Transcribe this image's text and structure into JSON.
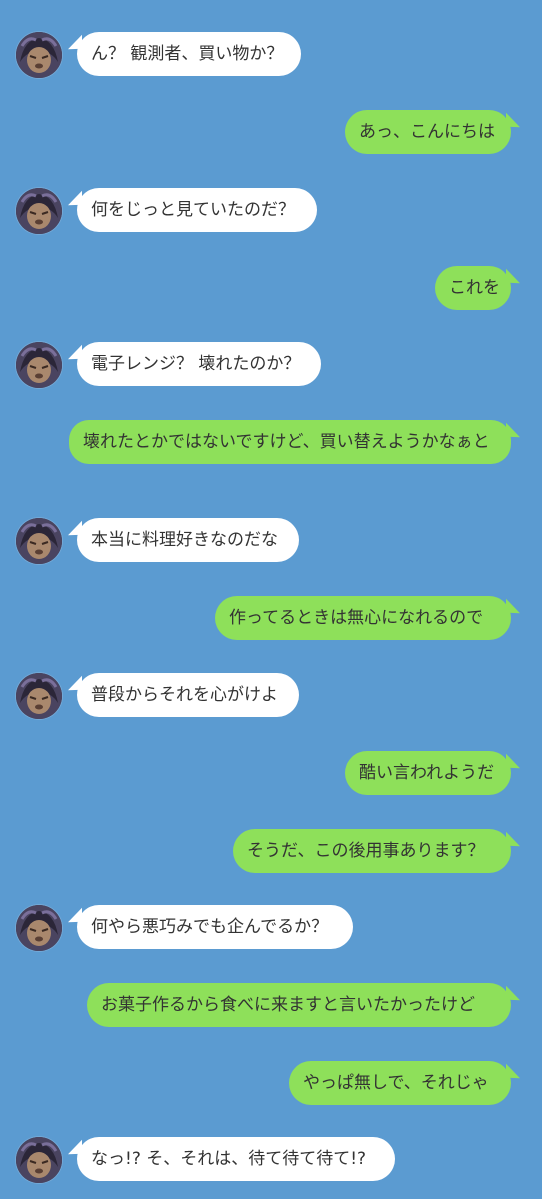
{
  "colors": {
    "background": "#5b9bd1",
    "incoming_bubble": "#ffffff",
    "outgoing_bubble": "#8ee05a",
    "text": "#333333"
  },
  "messages": [
    {
      "side": "left",
      "text": "ん？ 観測者、買い物か？"
    },
    {
      "side": "right",
      "text": "あっ、こんにちは"
    },
    {
      "side": "left",
      "text": "何をじっと見ていたのだ？"
    },
    {
      "side": "right",
      "text": "これを"
    },
    {
      "side": "left",
      "text": "電子レンジ？ 壊れたのか？"
    },
    {
      "side": "right",
      "text": "壊れたとかではないですけど、買い替えようかなぁと"
    },
    {
      "side": "left",
      "text": "本当に料理好きなのだな"
    },
    {
      "side": "right",
      "text": "作ってるときは無心になれるので"
    },
    {
      "side": "left",
      "text": "普段からそれを心がけよ"
    },
    {
      "side": "right",
      "text": "酷い言われようだ"
    },
    {
      "side": "right",
      "text": "そうだ、この後用事あります？"
    },
    {
      "side": "left",
      "text": "何やら悪巧みでも企んでるか？"
    },
    {
      "side": "right",
      "text": "お菓子作るから食べに来ますと言いたかったけど"
    },
    {
      "side": "right",
      "text": "やっぱ無しで、それじゃ"
    },
    {
      "side": "left",
      "text": "なっ!? そ、それは、待て待て待て!?"
    }
  ]
}
